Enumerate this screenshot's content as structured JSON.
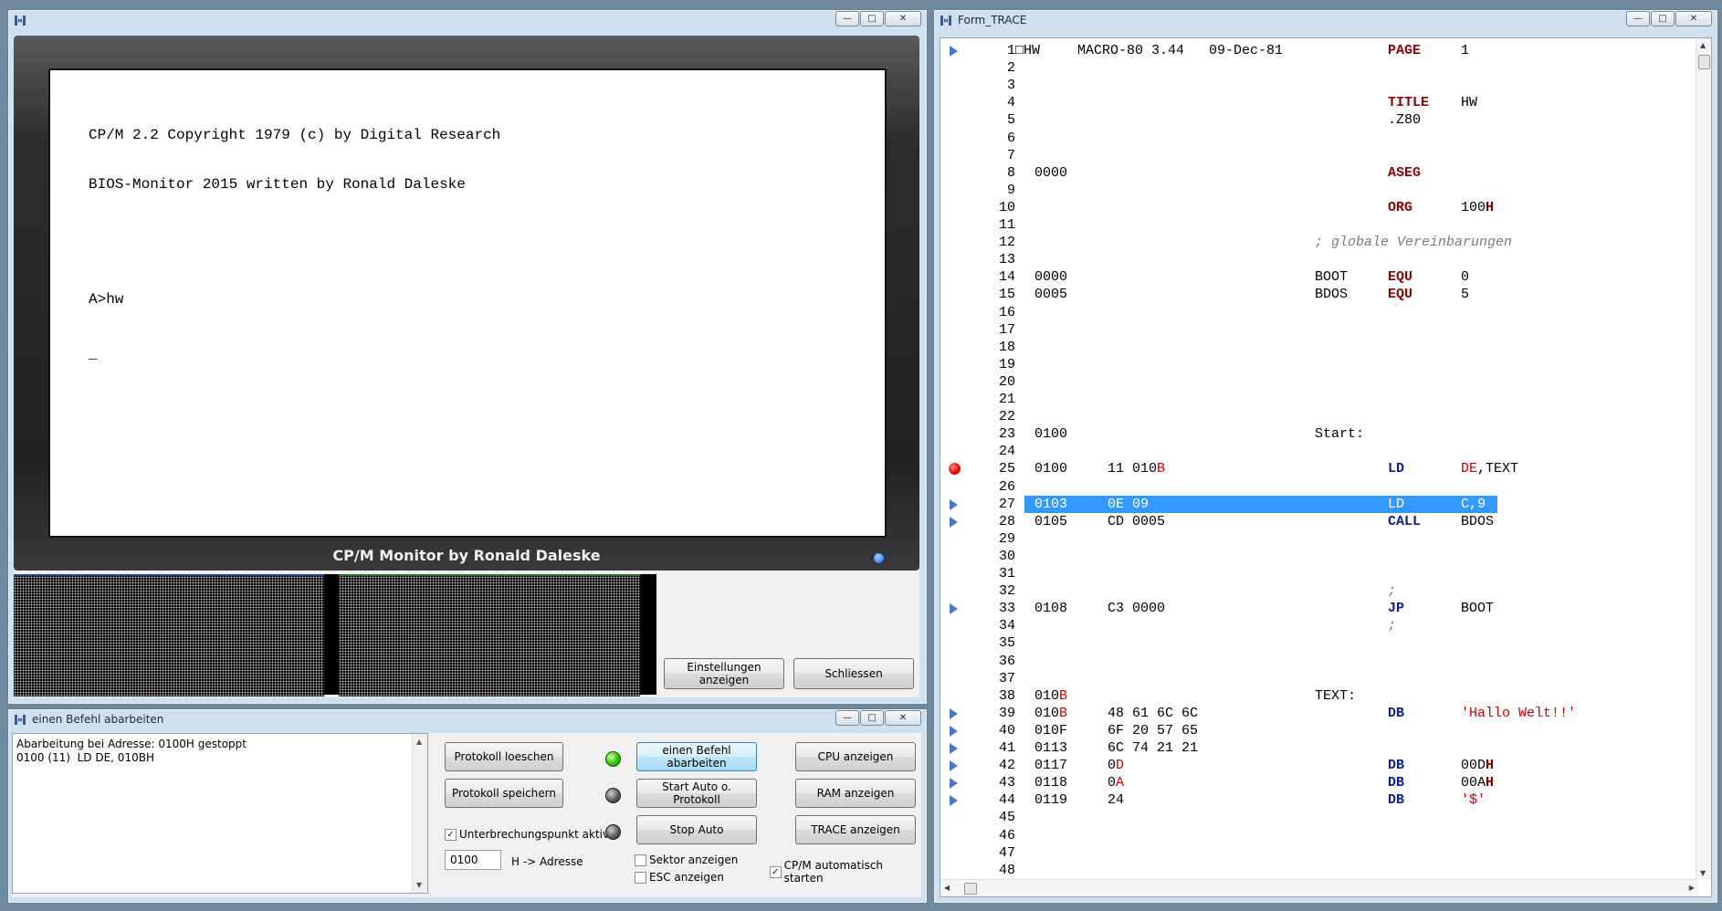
{
  "monitor_window": {
    "title": "",
    "crt_lines": [
      "CP/M 2.2 Copyright 1979 (c) by Digital Research",
      "BIOS-Monitor 2015 written by Ronald Daleske",
      "",
      "A>hw",
      "_"
    ],
    "bezel_label": "CP/M Monitor by Ronald Daleske",
    "settings_button": "Einstellungen anzeigen",
    "close_button": "Schliessen"
  },
  "step_window": {
    "title": "einen Befehl abarbeiten",
    "log_lines": [
      "Abarbeitung bei Adresse: 0100H gestoppt",
      "0100 (11)  LD DE, 010BH"
    ],
    "buttons": {
      "clear_log": "Protokoll loeschen",
      "save_log": "Protokoll speichern",
      "step": "einen Befehl abarbeiten",
      "auto": "Start Auto o. Protokoll",
      "stop": "Stop Auto",
      "cpu": "CPU anzeigen",
      "ram": "RAM anzeigen",
      "trace": "TRACE anzeigen"
    },
    "breakpoint_label": "Unterbrechungspunkt aktiv",
    "address_value": "0100",
    "address_suffix": "H -> Adresse",
    "sector_label": "Sektor anzeigen",
    "esc_label": "ESC anzeigen",
    "autostart_label": "CP/M automatisch starten"
  },
  "trace_window": {
    "title": "Form_TRACE",
    "lines": [
      {
        "n": "1",
        "addr": "□HW",
        "op": "MACRO-80 3.44   09-Dec-81",
        "label": "",
        "mn": "PAGE",
        "arg": "1",
        "mode": "dir",
        "marker": "play"
      },
      {
        "n": "2"
      },
      {
        "n": "3"
      },
      {
        "n": "4",
        "mn": "TITLE",
        "arg": "HW",
        "mode": "dir2"
      },
      {
        "n": "5",
        "mn": ".Z80",
        "mode": "plain"
      },
      {
        "n": "6"
      },
      {
        "n": "7"
      },
      {
        "n": "8",
        "addr": "0000",
        "mn": "ASEG",
        "mode": "dir"
      },
      {
        "n": "9"
      },
      {
        "n": "10",
        "mn": "ORG",
        "arg": "100H",
        "mode": "org"
      },
      {
        "n": "11"
      },
      {
        "n": "12",
        "comment": "; globale Vereinbarungen"
      },
      {
        "n": "13"
      },
      {
        "n": "14",
        "addr": "0000",
        "label": "BOOT",
        "mn": "EQU",
        "arg": "0",
        "mode": "dir"
      },
      {
        "n": "15",
        "addr": "0005",
        "label": "BDOS",
        "mn": "EQU",
        "arg": "5",
        "mode": "dir"
      },
      {
        "n": "16"
      },
      {
        "n": "17"
      },
      {
        "n": "18"
      },
      {
        "n": "19"
      },
      {
        "n": "20"
      },
      {
        "n": "21"
      },
      {
        "n": "22"
      },
      {
        "n": "23",
        "addr": "0100",
        "label": "Start:"
      },
      {
        "n": "24"
      },
      {
        "n": "25",
        "addr": "0100",
        "op": "11 010B",
        "mn": "LD",
        "arg": "DE,TEXT",
        "mode": "ld25",
        "marker": "break"
      },
      {
        "n": "26"
      },
      {
        "n": "27",
        "addr": "0103",
        "op": "0E 09",
        "mn": "LD",
        "arg": "C,9",
        "mode": "instr",
        "marker": "play",
        "highlight": true
      },
      {
        "n": "28",
        "addr": "0105",
        "op": "CD 0005",
        "mn": "CALL",
        "arg": "BDOS",
        "mode": "instr",
        "marker": "play"
      },
      {
        "n": "29"
      },
      {
        "n": "30"
      },
      {
        "n": "31"
      },
      {
        "n": "32",
        "mn": ";",
        "mode": "semi"
      },
      {
        "n": "33",
        "addr": "0108",
        "op": "C3 0000",
        "mn": "JP",
        "arg": "BOOT",
        "mode": "instr",
        "marker": "play"
      },
      {
        "n": "34",
        "mn": ";",
        "mode": "semi"
      },
      {
        "n": "35"
      },
      {
        "n": "36"
      },
      {
        "n": "37"
      },
      {
        "n": "38",
        "addr": "010B",
        "label": "TEXT:",
        "mode": "addrB"
      },
      {
        "n": "39",
        "addr": "010B",
        "op": "48 61 6C 6C",
        "mn": "DB",
        "arg": "'Hallo Welt!!'",
        "mode": "db",
        "marker": "play"
      },
      {
        "n": "40",
        "addr": "010F",
        "op": "6F 20 57 65",
        "marker": "play"
      },
      {
        "n": "41",
        "addr": "0113",
        "op": "6C 74 21 21",
        "marker": "play"
      },
      {
        "n": "42",
        "addr": "0117",
        "op": "0D",
        "mn": "DB",
        "arg": "00DH",
        "mode": "dbH",
        "marker": "play"
      },
      {
        "n": "43",
        "addr": "0118",
        "op": "0A",
        "mn": "DB",
        "arg": "00AH",
        "mode": "dbH",
        "marker": "play"
      },
      {
        "n": "44",
        "addr": "0119",
        "op": "24",
        "mn": "DB",
        "arg": "'$'",
        "mode": "db",
        "marker": "play"
      },
      {
        "n": "45"
      },
      {
        "n": "46"
      },
      {
        "n": "47"
      },
      {
        "n": "48"
      }
    ]
  },
  "colors": {
    "selection": "#3399ff",
    "crt_bg": "#ffffff",
    "bezel": "#2a2a2a",
    "keyword": "#0b1e8f",
    "string": "#cc0000",
    "comment": "#7a7a7a"
  }
}
